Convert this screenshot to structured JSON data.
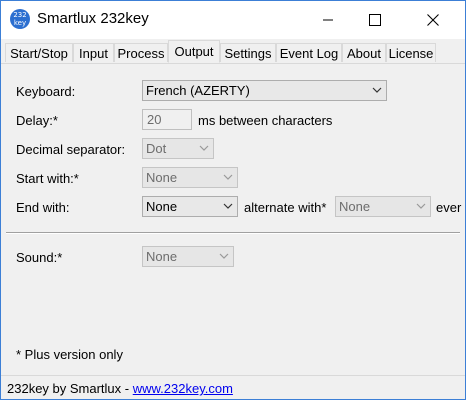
{
  "window": {
    "title": "Smartlux 232key",
    "icon_text": "232 key",
    "controls": {
      "minimize": "minimize-icon",
      "maximize": "maximize-icon",
      "close": "close-icon"
    }
  },
  "tabs": [
    {
      "label": "Start/Stop",
      "active": false
    },
    {
      "label": "Input",
      "active": false
    },
    {
      "label": "Process",
      "active": false
    },
    {
      "label": "Output",
      "active": true
    },
    {
      "label": "Settings",
      "active": false
    },
    {
      "label": "Event Log",
      "active": false
    },
    {
      "label": "About",
      "active": false
    },
    {
      "label": "License",
      "active": false
    }
  ],
  "form": {
    "keyboard": {
      "label": "Keyboard:",
      "value": "French (AZERTY)"
    },
    "delay": {
      "label": "Delay:*",
      "value": "20",
      "suffix": "ms between characters"
    },
    "decimal": {
      "label": "Decimal separator:",
      "value": "Dot"
    },
    "start_with": {
      "label": "Start with:*",
      "value": "None"
    },
    "end_with": {
      "label": "End with:",
      "value": "None",
      "alternate_label": "alternate with*",
      "alternate_value": "None",
      "trailing_text": "ever"
    },
    "sound": {
      "label": "Sound:*",
      "value": "None"
    },
    "note": "* Plus version only"
  },
  "status": {
    "prefix": "232key by Smartlux - ",
    "link": "www.232key.com"
  },
  "colors": {
    "window_border": "#3c7fd6",
    "link": "#0000ee",
    "icon_bg": "#2c6fd0"
  }
}
